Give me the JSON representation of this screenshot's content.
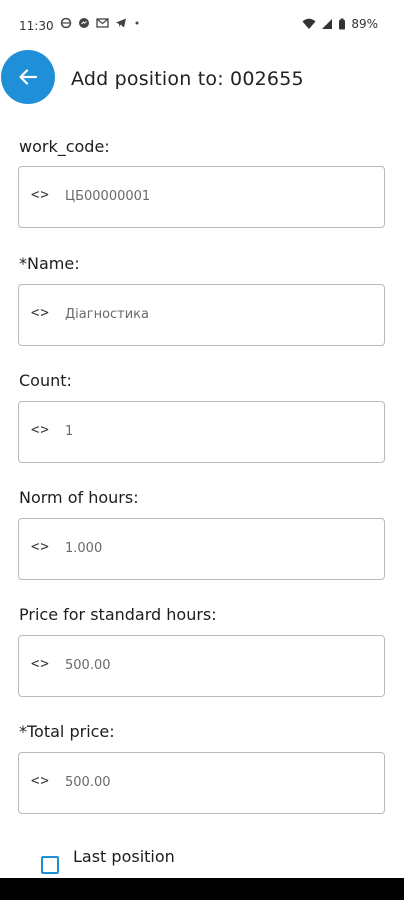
{
  "status_bar": {
    "time": "11:30",
    "icons": [
      "vpn-icon",
      "messenger-icon",
      "mail-icon",
      "telegram-icon",
      "dot-icon"
    ],
    "battery_percent": "89%"
  },
  "header": {
    "title": "Add position to: 002655",
    "back_icon": "arrow-left-icon",
    "accent_color": "#1f8fd8"
  },
  "fields": [
    {
      "label": "work_code:",
      "value": "ЦБ00000001"
    },
    {
      "label": "*Name:",
      "value": "Діагностика"
    },
    {
      "label": "Count:",
      "value": "1"
    },
    {
      "label": "Norm of hours:",
      "value": "1.000"
    },
    {
      "label": "Price for standard hours:",
      "value": "500.00"
    },
    {
      "label": "*Total price:",
      "value": "500.00"
    }
  ],
  "last_position": {
    "label": "Last position",
    "checked": false
  }
}
